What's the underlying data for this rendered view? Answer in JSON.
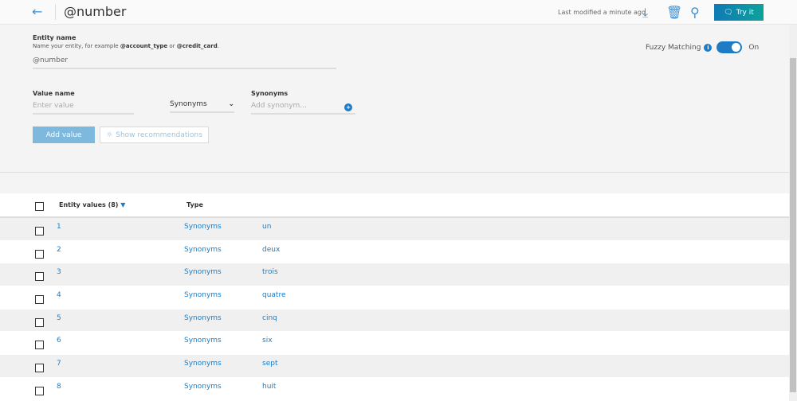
{
  "header": {
    "title": "@number",
    "last_modified": "Last modified a minute ago",
    "try_label": "Try it"
  },
  "form": {
    "entity_name_label": "Entity name",
    "hint_prefix": "Name your entity, for example ",
    "hint_ex1": "@account_type",
    "hint_or": " or ",
    "hint_ex2": "@credit_card",
    "hint_suffix": ".",
    "entity_value": "@number",
    "fuzzy_label": "Fuzzy Matching",
    "fuzzy_state": "On",
    "value_name_label": "Value name",
    "value_placeholder": "Enter value",
    "type_select": "Synonyms",
    "synonyms_label": "Synonyms",
    "synonym_placeholder": "Add synonym...",
    "add_value": "Add value",
    "show_recs": "Show recommendations"
  },
  "table": {
    "col_values": "Entity values (8)",
    "col_type": "Type",
    "rows": [
      {
        "value": "1",
        "type": "Synonyms",
        "syn": "un"
      },
      {
        "value": "2",
        "type": "Synonyms",
        "syn": "deux"
      },
      {
        "value": "3",
        "type": "Synonyms",
        "syn": "trois"
      },
      {
        "value": "4",
        "type": "Synonyms",
        "syn": "quatre"
      },
      {
        "value": "5",
        "type": "Synonyms",
        "syn": "cinq"
      },
      {
        "value": "6",
        "type": "Synonyms",
        "syn": "six"
      },
      {
        "value": "7",
        "type": "Synonyms",
        "syn": "sept"
      },
      {
        "value": "8",
        "type": "Synonyms",
        "syn": "huit"
      }
    ]
  }
}
